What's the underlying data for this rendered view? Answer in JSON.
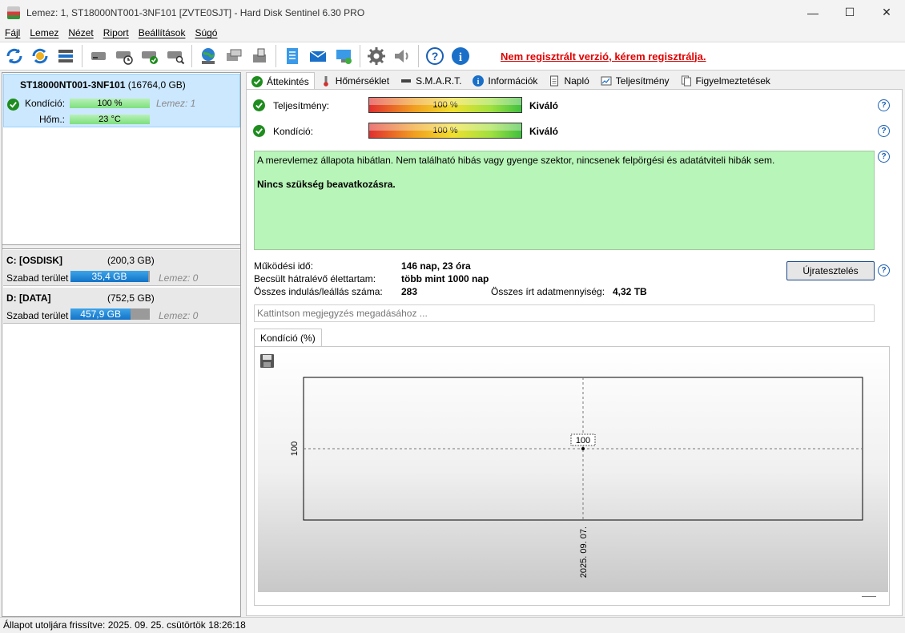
{
  "window": {
    "title": "Lemez: 1, ST18000NT001-3NF101 [ZVTE0SJT]  -  Hard Disk Sentinel 6.30 PRO",
    "minimize": "—",
    "maximize": "☐",
    "close": "✕"
  },
  "menu": [
    "Fájl",
    "Lemez",
    "Nézet",
    "Riport",
    "Beállítások",
    "Súgó"
  ],
  "toolbar": {
    "unregistered": "Nem regisztrált verzió, kérem regisztrálja."
  },
  "left": {
    "disk": {
      "name": "ST18000NT001-3NF101",
      "size": "(16764,0 GB)",
      "condition_label": "Kondíció:",
      "condition_value": "100 %",
      "lemez": "Lemez: 1",
      "temp_label": "Hőm.:",
      "temp_value": "23 °C"
    },
    "partitions": [
      {
        "name": "C: [OSDISK]",
        "size": "(200,3 GB)",
        "free_label": "Szabad terület",
        "free_value": "35,4 GB",
        "lemez": "Lemez: 0",
        "free_fraction": 0.98
      },
      {
        "name": "D: [DATA]",
        "size": "(752,5 GB)",
        "free_label": "Szabad terület",
        "free_value": "457,9 GB",
        "lemez": "Lemez: 0",
        "free_fraction": 0.76
      }
    ]
  },
  "tabs": [
    "Áttekintés",
    "Hőmérséklet",
    "S.M.A.R.T.",
    "Információk",
    "Napló",
    "Teljesítmény",
    "Figyelmeztetések"
  ],
  "overview": {
    "performance_label": "Teljesítmény:",
    "performance_value": "100 %",
    "performance_verdict": "Kiváló",
    "condition_label": "Kondíció:",
    "condition_value": "100 %",
    "condition_verdict": "Kiváló",
    "status_text": "A merevlemez állapota hibátlan. Nem található hibás vagy gyenge szektor, nincsenek felpörgési és adatátviteli hibák sem.",
    "action_text": "Nincs szükség beavatkozásra.",
    "uptime_label": "Működési idő:",
    "uptime_value": "146 nap, 23 óra",
    "lifetime_label": "Becsült hátralévő élettartam:",
    "lifetime_value": "több mint 1000 nap",
    "startstop_label": "Összes indulás/leállás száma:",
    "startstop_value": "283",
    "written_label": "Összes írt adatmennyiség:",
    "written_value": "4,32 TB",
    "retest_button": "Újratesztelés",
    "note_placeholder": "Kattintson megjegyzés megadásához ..."
  },
  "chart_tab": "Kondíció  (%)",
  "chart_data": {
    "type": "line",
    "x": [
      "2025. 09. 07."
    ],
    "series": [
      {
        "values": [
          100
        ]
      }
    ],
    "yticks": [
      "100"
    ],
    "data_labels": [
      "100"
    ]
  },
  "statusbar": {
    "text": "Állapot utoljára frissítve: 2025. 09. 25. csütörtök 18:26:18"
  }
}
